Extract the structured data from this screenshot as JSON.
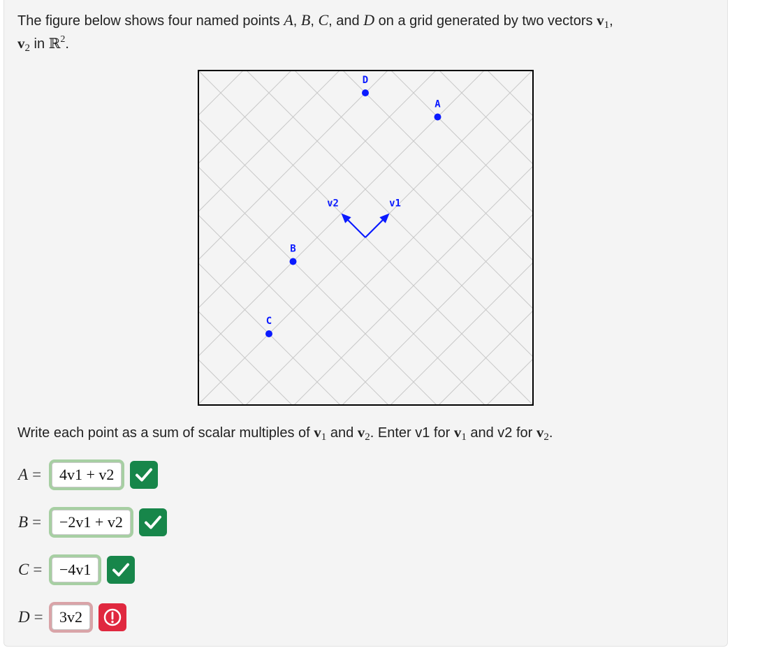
{
  "intro": {
    "text_1": "The figure below shows four named points ",
    "A": "A",
    "comma_1": ", ",
    "B": "B",
    "comma_2": ", ",
    "C": "C",
    "and": ", and ",
    "D": "D",
    "text_2": " on a grid generated by two vectors ",
    "v1_main": "v",
    "v1_sub": "1",
    "comma_3": ",",
    "v2_main": "v",
    "v2_sub": "2",
    "text_3": " in ",
    "R": "ℝ",
    "R_sup": "2",
    "period": "."
  },
  "figure": {
    "points": [
      {
        "label": "A",
        "u": 4,
        "v": 1
      },
      {
        "label": "B",
        "u": -2,
        "v": 1
      },
      {
        "label": "C",
        "u": -4,
        "v": 0
      },
      {
        "label": "D",
        "u": 3,
        "v": 3
      }
    ],
    "vectors": [
      {
        "label": "v1",
        "u": 1,
        "v": 0
      },
      {
        "label": "v2",
        "u": 0,
        "v": 1
      }
    ],
    "colors": {
      "grid": "#c8c8c8",
      "blue": "#0a1aff",
      "border": "#000000"
    }
  },
  "instructions": {
    "t1": "Write each point as a sum of scalar multiples of ",
    "v1_main": "v",
    "v1_sub": "1",
    "t2": " and ",
    "v2_main": "v",
    "v2_sub": "2",
    "t3": ". Enter v1 for ",
    "v1b_main": "v",
    "v1b_sub": "1",
    "t4": " and v2 for ",
    "v2b_main": "v",
    "v2b_sub": "2",
    "t5": "."
  },
  "answers": [
    {
      "label": "A",
      "eq": "=",
      "value": "4v1 + v2",
      "status": "correct",
      "icon": "check-icon"
    },
    {
      "label": "B",
      "eq": "=",
      "value": "−2v1 + v2",
      "status": "correct",
      "icon": "check-icon"
    },
    {
      "label": "C",
      "eq": "=",
      "value": "−4v1",
      "status": "correct",
      "icon": "check-icon"
    },
    {
      "label": "D",
      "eq": "=",
      "value": "3v2",
      "status": "incorrect",
      "icon": "exclamation-circle-icon"
    }
  ]
}
